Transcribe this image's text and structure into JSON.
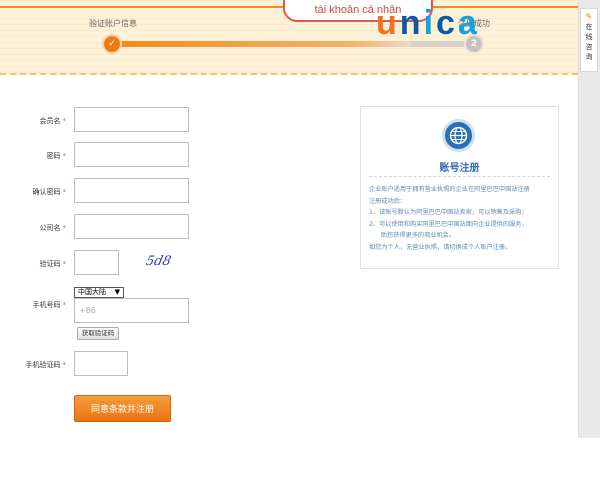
{
  "steps": {
    "step1_label": "验证账户信息",
    "step2_label": "注册成功",
    "step1_mark": "✓",
    "step2_number": "2"
  },
  "overlay": {
    "bubble_text": "tài khoản cá nhân"
  },
  "logo": {
    "letters": [
      "u",
      "n",
      "i",
      "c",
      "a"
    ]
  },
  "side_tab": {
    "icon": "pencil-icon",
    "label": "在线咨询"
  },
  "form": {
    "member_name_label": "会员名",
    "password_label": "密码",
    "confirm_password_label": "确认密码",
    "company_name_label": "公司名",
    "captcha_label": "验证码",
    "captcha_image_text": "5d8",
    "mobile_label": "手机号码",
    "country_select": "中国大陆",
    "mobile_placeholder": "+86",
    "get_code_button": "获取验证码",
    "sms_code_label": "手机验证码",
    "submit_button": "同意条款并注册",
    "required_mark": "*"
  },
  "info_card": {
    "icon": "globe-icon",
    "title": "账号注册",
    "lines": [
      "企业账户适用于拥有营业执照的企业在阿里巴巴中国站注册",
      "注册成功后：",
      "1、该账号默认为阿里巴巴中国站卖家，可以销售及采购；",
      "2、可以使用和购买阿里巴巴中国站面向企业提供的服务，",
      "      助您获得更多的商业机会。",
      "如您为个人，无营业执照，请切换成个人账户注册。"
    ]
  },
  "colors": {
    "accent_orange": "#f08a1c",
    "card_blue": "#2a6db5",
    "bubble_red": "#e2574c"
  }
}
